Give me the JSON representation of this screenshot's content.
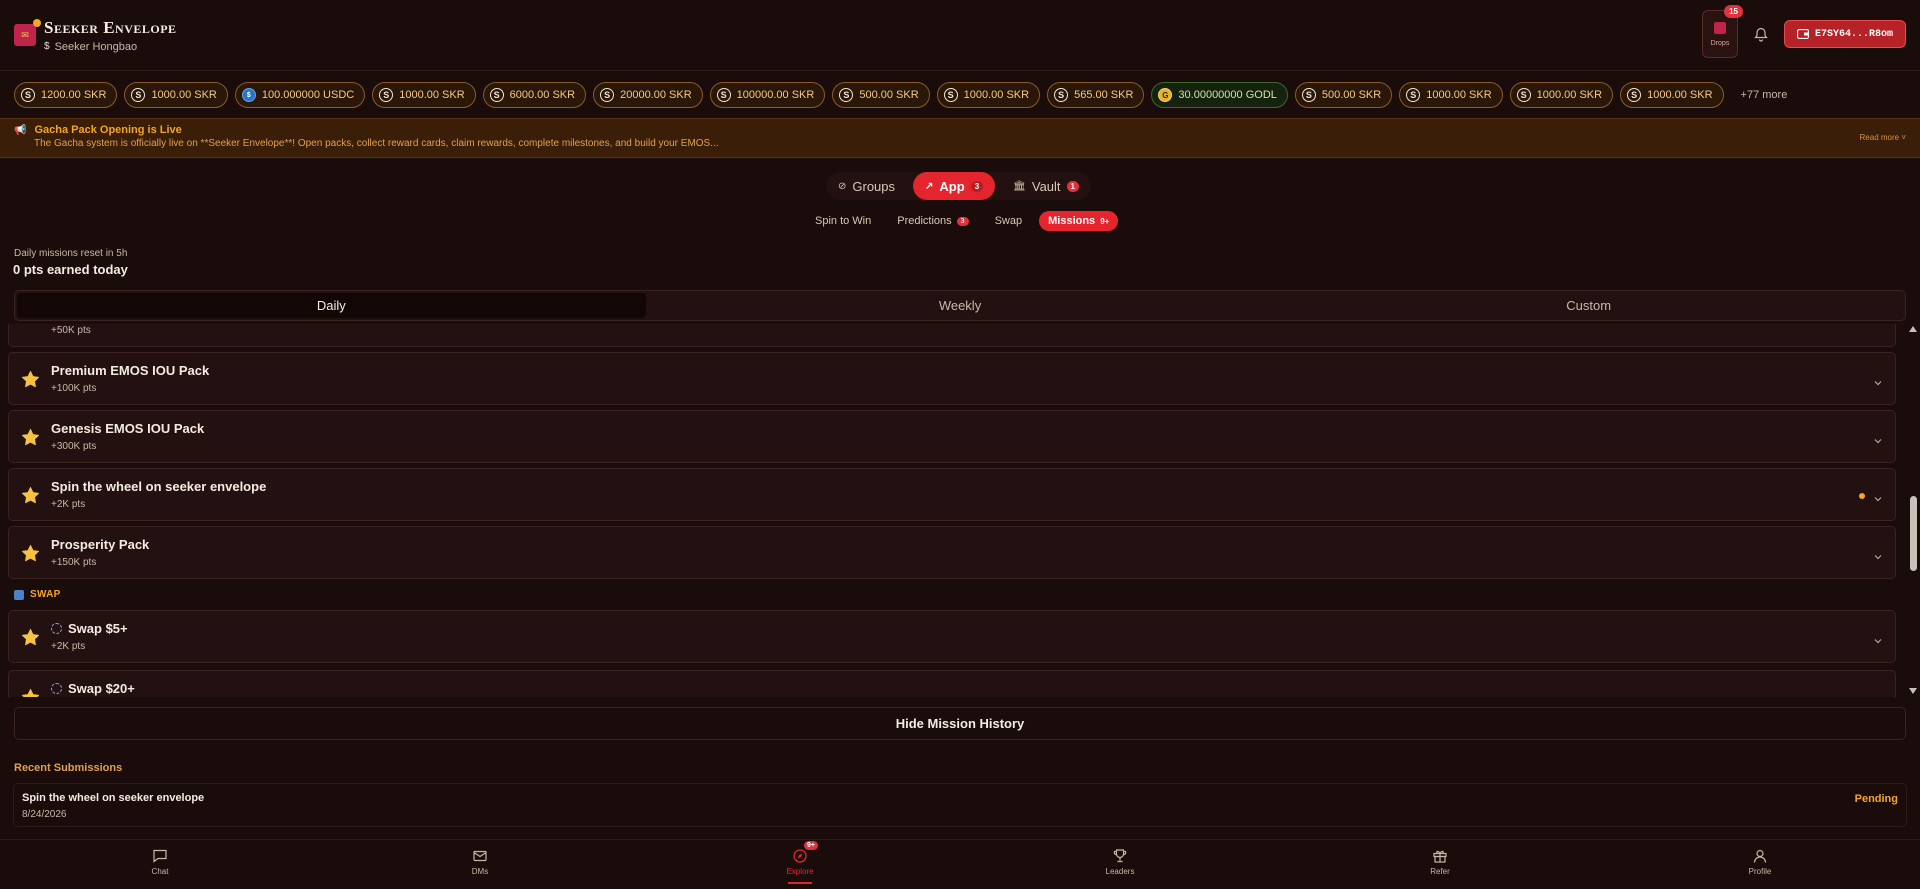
{
  "header": {
    "brand_title": "Seeker Envelope",
    "brand_subtitle": "Seeker Hongbao",
    "drops_label": "Drops",
    "drops_badge": "15",
    "wallet_label": "E7SY64...R8om"
  },
  "tokens": [
    {
      "amount": "1200.00 SKR",
      "icon": "s-coin",
      "style": "default"
    },
    {
      "amount": "1000.00 SKR",
      "icon": "s-coin",
      "style": "default"
    },
    {
      "amount": "100.000000 USDC",
      "icon": "usdc-coin",
      "style": "default"
    },
    {
      "amount": "1000.00 SKR",
      "icon": "s-coin",
      "style": "default"
    },
    {
      "amount": "6000.00 SKR",
      "icon": "s-coin",
      "style": "default"
    },
    {
      "amount": "20000.00 SKR",
      "icon": "s-coin",
      "style": "default"
    },
    {
      "amount": "100000.00 SKR",
      "icon": "s-coin",
      "style": "default"
    },
    {
      "amount": "500.00 SKR",
      "icon": "s-coin",
      "style": "default"
    },
    {
      "amount": "1000.00 SKR",
      "icon": "s-coin",
      "style": "default"
    },
    {
      "amount": "565.00 SKR",
      "icon": "s-coin",
      "style": "default"
    },
    {
      "amount": "30.00000000 GODL",
      "icon": "godl-coin",
      "style": "green"
    },
    {
      "amount": "500.00 SKR",
      "icon": "s-coin",
      "style": "default"
    },
    {
      "amount": "1000.00 SKR",
      "icon": "s-coin",
      "style": "default"
    },
    {
      "amount": "1000.00 SKR",
      "icon": "s-coin",
      "style": "default"
    },
    {
      "amount": "1000.00 SKR",
      "icon": "s-coin",
      "style": "default"
    }
  ],
  "tokens_more": "+77 more",
  "announcement": {
    "title": "Gacha Pack Opening is Live",
    "body": "The Gacha system is officially live on **Seeker Envelope**! Open packs, collect reward cards, claim rewards, complete milestones, and build your EMOS...",
    "read_more": "Read more"
  },
  "main_tabs": [
    {
      "label": "Groups",
      "badge": "",
      "active": false,
      "icon": "compass-icon"
    },
    {
      "label": "App",
      "badge": "3",
      "active": true,
      "icon": "trend-icon"
    },
    {
      "label": "Vault",
      "badge": "1",
      "active": false,
      "icon": "bank-icon"
    }
  ],
  "sub_tabs": [
    {
      "label": "Spin to Win",
      "badge": "",
      "active": false
    },
    {
      "label": "Predictions",
      "badge": "3",
      "active": false
    },
    {
      "label": "Swap",
      "badge": "",
      "active": false
    },
    {
      "label": "Missions",
      "badge": "9+",
      "active": true
    }
  ],
  "missions_summary": {
    "reset_text": "Daily missions reset in 5h",
    "earned_text": "0 pts earned today"
  },
  "period_tabs": [
    {
      "label": "Daily",
      "active": true
    },
    {
      "label": "Weekly",
      "active": false
    },
    {
      "label": "Custom",
      "active": false
    }
  ],
  "mission_list": {
    "partial_top_pts": "+50K pts",
    "items": [
      {
        "title": "Premium EMOS IOU Pack",
        "pts": "+100K pts",
        "dot": false,
        "swap_icon": false
      },
      {
        "title": "Genesis EMOS IOU Pack",
        "pts": "+300K pts",
        "dot": false,
        "swap_icon": false
      },
      {
        "title": "Spin the wheel on seeker envelope",
        "pts": "+2K pts",
        "dot": true,
        "swap_icon": false
      },
      {
        "title": "Prosperity Pack",
        "pts": "+150K pts",
        "dot": false,
        "swap_icon": false
      }
    ],
    "swap_section_label": "SWAP",
    "swap_items": [
      {
        "title": "Swap $5+",
        "pts": "+2K pts",
        "dot": false,
        "swap_icon": true
      },
      {
        "title": "Swap $20+",
        "pts": "",
        "dot": false,
        "swap_icon": true
      }
    ]
  },
  "hide_history_label": "Hide Mission History",
  "recent": {
    "heading": "Recent Submissions",
    "items": [
      {
        "title": "Spin the wheel on seeker envelope",
        "date": "8/24/2026",
        "status": "Pending"
      }
    ]
  },
  "bottom_nav": [
    {
      "label": "Chat",
      "icon": "chat-icon",
      "active": false,
      "badge": ""
    },
    {
      "label": "DMs",
      "icon": "mail-icon",
      "active": false,
      "badge": ""
    },
    {
      "label": "Explore",
      "icon": "explore-icon",
      "active": true,
      "badge": "9+"
    },
    {
      "label": "Leaders",
      "icon": "trophy-icon",
      "active": false,
      "badge": ""
    },
    {
      "label": "Refer",
      "icon": "gift-icon",
      "active": false,
      "badge": ""
    },
    {
      "label": "Profile",
      "icon": "user-icon",
      "active": false,
      "badge": ""
    }
  ],
  "colors": {
    "background": "#190c0b",
    "accent_red": "#e5252e",
    "accent_orange": "#f5a524",
    "card": "#221110"
  }
}
